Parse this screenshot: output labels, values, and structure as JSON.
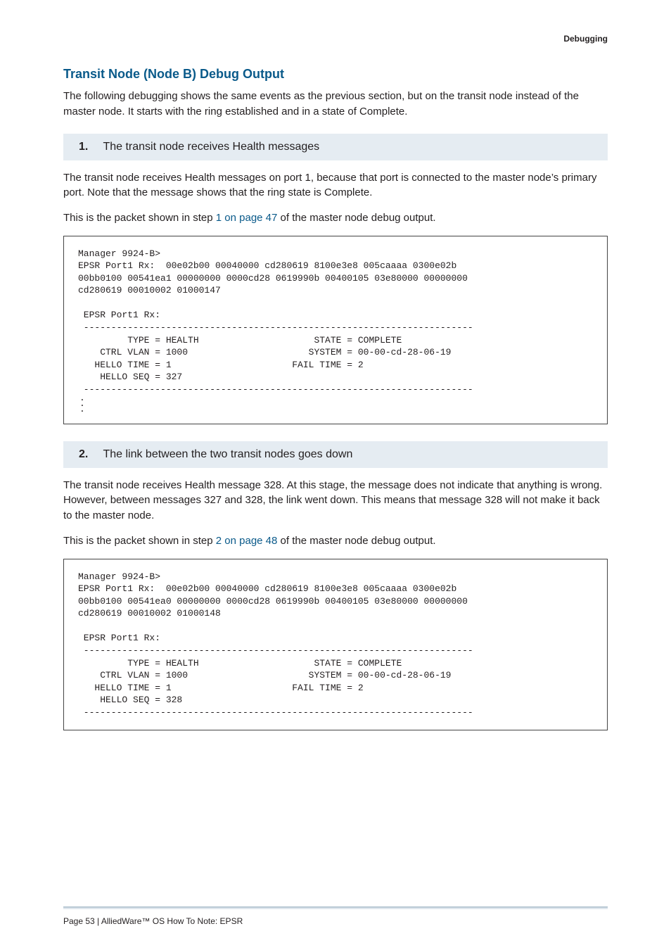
{
  "running_header": "Debugging",
  "section": {
    "title": "Transit Node (Node B) Debug Output",
    "intro": "The following debugging shows the same events as the previous section, but on the transit node instead of the master node. It starts with the ring established and in a state of Complete."
  },
  "step1": {
    "num": "1.",
    "label": "The transit node receives Health messages",
    "para1": "The transit node receives Health messages on port 1, because that port is connected to the master node’s primary port. Note that the message shows that the ring state is Complete.",
    "para2_a": "This is the packet shown in step ",
    "para2_link": "1 on page 47",
    "para2_b": " of the master node debug output.",
    "code": "Manager 9924-B>\nEPSR Port1 Rx:  00e02b00 00040000 cd280619 8100e3e8 005caaaa 0300e02b \n00bb0100 00541ea1 00000000 0000cd28 0619990b 00400105 03e80000 00000000 \ncd280619 00010002 01000147\n\n EPSR Port1 Rx:\n -----------------------------------------------------------------------\n         TYPE = HEALTH                     STATE = COMPLETE\n    CTRL VLAN = 1000                      SYSTEM = 00-00-cd-28-06-19\n   HELLO TIME = 1                      FAIL TIME = 2\n    HELLO SEQ = 327 \n -----------------------------------------------------------------------",
    "dots": ".\n.\n."
  },
  "step2": {
    "num": "2.",
    "label": "The link between the two transit nodes goes down",
    "para1": "The transit node receives Health message 328. At this stage, the message does not indicate that anything is wrong. However, between messages 327 and 328, the link went down. This means that message 328 will not make it back to the master node.",
    "para2_a": "This is the packet shown in step ",
    "para2_link": "2 on page 48",
    "para2_b": " of the master node debug output.",
    "code": "Manager 9924-B>\nEPSR Port1 Rx:  00e02b00 00040000 cd280619 8100e3e8 005caaaa 0300e02b \n00bb0100 00541ea0 00000000 0000cd28 0619990b 00400105 03e80000 00000000 \ncd280619 00010002 01000148\n\n EPSR Port1 Rx:\n -----------------------------------------------------------------------\n         TYPE = HEALTH                     STATE = COMPLETE\n    CTRL VLAN = 1000                      SYSTEM = 00-00-cd-28-06-19\n   HELLO TIME = 1                      FAIL TIME = 2\n    HELLO SEQ = 328\n -----------------------------------------------------------------------"
  },
  "footer": "Page 53 | AlliedWare™ OS How To Note: EPSR"
}
